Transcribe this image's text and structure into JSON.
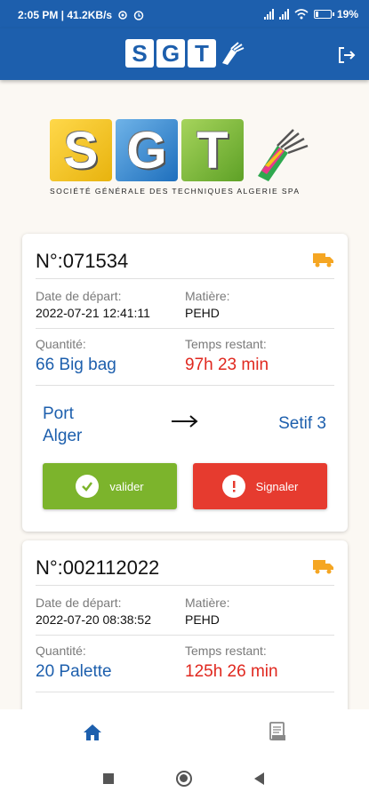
{
  "status_bar": {
    "time_and_speed": "2:05 PM | 41.2KB/s",
    "battery": "19%"
  },
  "app_bar": {
    "logo_letters": [
      "S",
      "G",
      "T"
    ],
    "logout_icon": "logout-icon"
  },
  "company": {
    "logo_letters": [
      "S",
      "G",
      "T"
    ],
    "subtitle": "SOCIÉTÉ GÉNÉRALE DES TECHNIQUES ALGERIE SPA"
  },
  "colors": {
    "primary": "#1d5fad",
    "accent_orange": "#f5a623",
    "remaining_red": "#e0281f",
    "valider_green": "#7cb42c",
    "signaler_red": "#e63b2f"
  },
  "labels": {
    "date_depart": "Date de départ:",
    "matiere": "Matière:",
    "quantite": "Quantité:",
    "temps_restant": "Temps restant:"
  },
  "shipments": [
    {
      "number": "N°:071534",
      "date_depart": "2022-07-21 12:41:11",
      "matiere": "PEHD",
      "quantite": "66 Big bag",
      "temps_restant": "97h 23 min",
      "origin_line1": "Port",
      "origin_line2": "Alger",
      "destination": "Setif 3",
      "valider_label": "valider",
      "signaler_label": "Signaler"
    },
    {
      "number": "N°:002112022",
      "date_depart": "2022-07-20 08:38:52",
      "matiere": "PEHD",
      "quantite": "20 Palette",
      "temps_restant": "125h 26 min"
    }
  ],
  "icons": {
    "truck": "truck-icon",
    "arrow": "arrow-right-icon",
    "check": "check-circle-icon",
    "alert": "alert-circle-icon",
    "home": "home-icon",
    "document": "document-icon"
  }
}
